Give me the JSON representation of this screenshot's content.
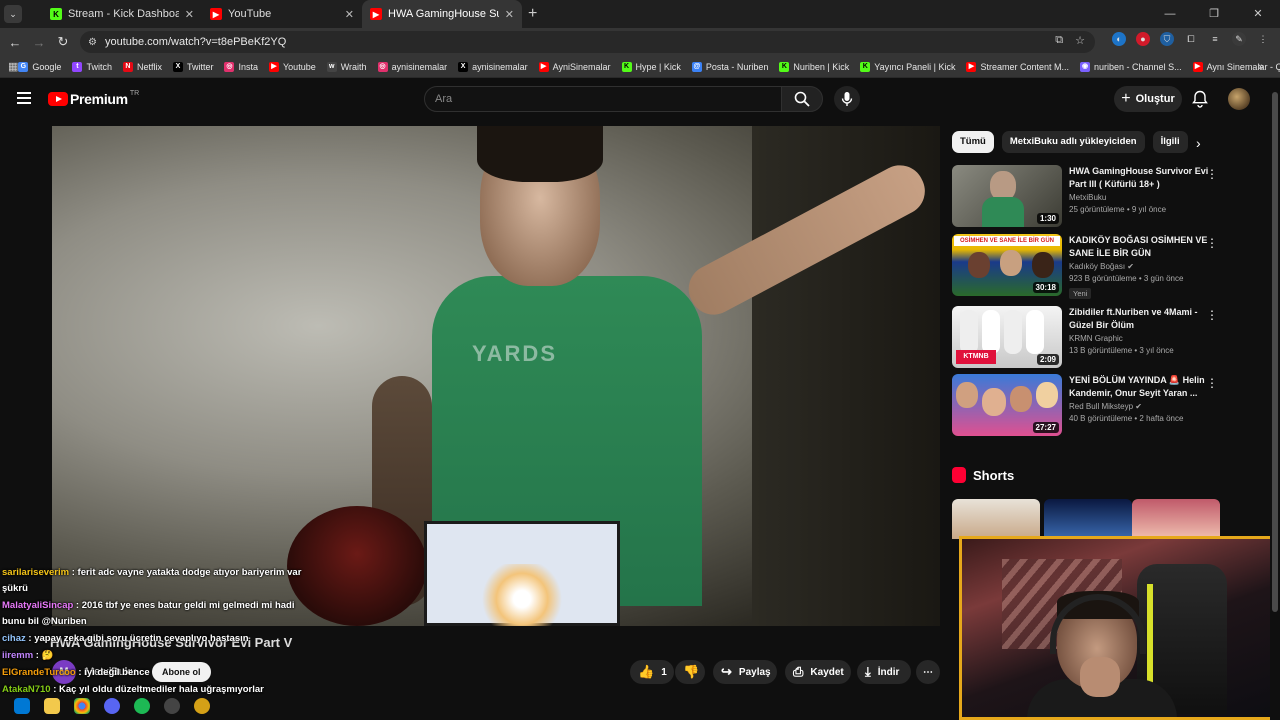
{
  "browser": {
    "tabs": [
      {
        "title": "Stream - Kick Dashboard",
        "fav_color": "#53fc18",
        "fav_glyph": "K"
      },
      {
        "title": "YouTube",
        "fav_color": "#ff0000",
        "fav_glyph": "▶"
      },
      {
        "title": "HWA GamingHouse Survivor Evi",
        "fav_color": "#ff0000",
        "fav_glyph": "▶",
        "active": true
      }
    ],
    "url": "youtube.com/watch?v=t8ePBeKf2YQ",
    "bookmarks": [
      {
        "label": "Google",
        "color": "#4285f4",
        "glyph": "G"
      },
      {
        "label": "Twitch",
        "color": "#9146ff",
        "glyph": "t"
      },
      {
        "label": "Netflix",
        "color": "#e50914",
        "glyph": "N"
      },
      {
        "label": "Twitter",
        "color": "#000000",
        "glyph": "X"
      },
      {
        "label": "Insta",
        "color": "#e1306c",
        "glyph": "◎"
      },
      {
        "label": "Youtube",
        "color": "#ff0000",
        "glyph": "▶"
      },
      {
        "label": "Wraith",
        "color": "#444444",
        "glyph": "w"
      },
      {
        "label": "aynisinemalar",
        "color": "#e1306c",
        "glyph": "◎"
      },
      {
        "label": "aynisinemalar",
        "color": "#000000",
        "glyph": "X"
      },
      {
        "label": "AyniSinemalar",
        "color": "#ff0000",
        "glyph": "▶"
      },
      {
        "label": "Hype | Kick",
        "color": "#53fc18",
        "glyph": "K"
      },
      {
        "label": "Posta - Nuriben",
        "color": "#3b82f6",
        "glyph": "@"
      },
      {
        "label": "Nuriben | Kick",
        "color": "#53fc18",
        "glyph": "K"
      },
      {
        "label": "Yayıncı Paneli | Kick",
        "color": "#53fc18",
        "glyph": "K"
      },
      {
        "label": "Streamer Content M...",
        "color": "#ff0000",
        "glyph": "▶"
      },
      {
        "label": "nuriben - Channel S...",
        "color": "#7b61ff",
        "glyph": "◉"
      },
      {
        "label": "Aynı Sinemalar - Ça...",
        "color": "#ff0000",
        "glyph": "▶"
      }
    ]
  },
  "youtube": {
    "logo_text": "Premium",
    "logo_region": "TR",
    "search_placeholder": "Ara",
    "create_label": "Oluştur",
    "video_overlay_text": "YARDS",
    "video_title": "HWA GamingHouse Survivor Evi Part V",
    "channel_avatar_letter": "M",
    "channel_name": "MetxiBuku",
    "subscribe_label": "Abone ol",
    "like_count": "1",
    "share_label": "Paylaş",
    "save_label": "Kaydet",
    "download_label": "İndir",
    "chips": [
      "Tümü",
      "MetxiBuku adlı yükleyiciden",
      "İlgili"
    ],
    "recommended": [
      {
        "title": "HWA GamingHouse Survivor Evi Part III ( Küfürlü 18+ )",
        "channel": "MetxiBuku",
        "meta": "25 görüntüleme • 9 yıl önce",
        "duration": "1:30",
        "verified": false,
        "badge": ""
      },
      {
        "title": "KADIKÖY BOĞASI OSİMHEN VE SANE İLE BİR GÜN",
        "channel": "Kadıköy Boğası",
        "meta": "923 B görüntüleme • 3 gün önce",
        "duration": "30:18",
        "verified": true,
        "badge": "Yeni"
      },
      {
        "title": "Zibidiler ft.Nuriben ve 4Mami - Güzel Bir Ölüm",
        "channel": "KRMN Graphic",
        "meta": "13 B görüntüleme • 3 yıl önce",
        "duration": "2:09",
        "verified": false,
        "badge": ""
      },
      {
        "title": "YENİ BÖLÜM YAYINDA 🚨 Helin Kandemir, Onur Seyit Yaran ...",
        "channel": "Red Bull Miksteyp",
        "meta": "40 B görüntüleme • 2 hafta önce",
        "duration": "27:27",
        "verified": true,
        "badge": ""
      }
    ],
    "shorts_title": "Shorts"
  },
  "chat": [
    {
      "user": "sarilariseverim",
      "color": "#f5c518",
      "text": " : ferit adc vayne yatakta dodge atıyor bariyerim var şükrü"
    },
    {
      "user": "MalatyaliSincap",
      "color": "#e879f9",
      "text": " : 2016 tbf ye enes batur geldi mi gelmedi mi hadi bunu bil @Nuriben"
    },
    {
      "user": "cihaz",
      "color": "#93c5fd",
      "text": " : yapay zeka gibi soru ücretin cevaplıyo hastasın"
    },
    {
      "user": "iiremm",
      "color": "#c084fc",
      "text": " : 🤔"
    },
    {
      "user": "ElGrandeTurcoo",
      "color": "#f59e0b",
      "text": " : iyi değil bence"
    },
    {
      "user": "AtakaN710",
      "color": "#84cc16",
      "text": " : Kaç yıl oldu düzeltmediler hala uğraşmıyorlar"
    }
  ]
}
